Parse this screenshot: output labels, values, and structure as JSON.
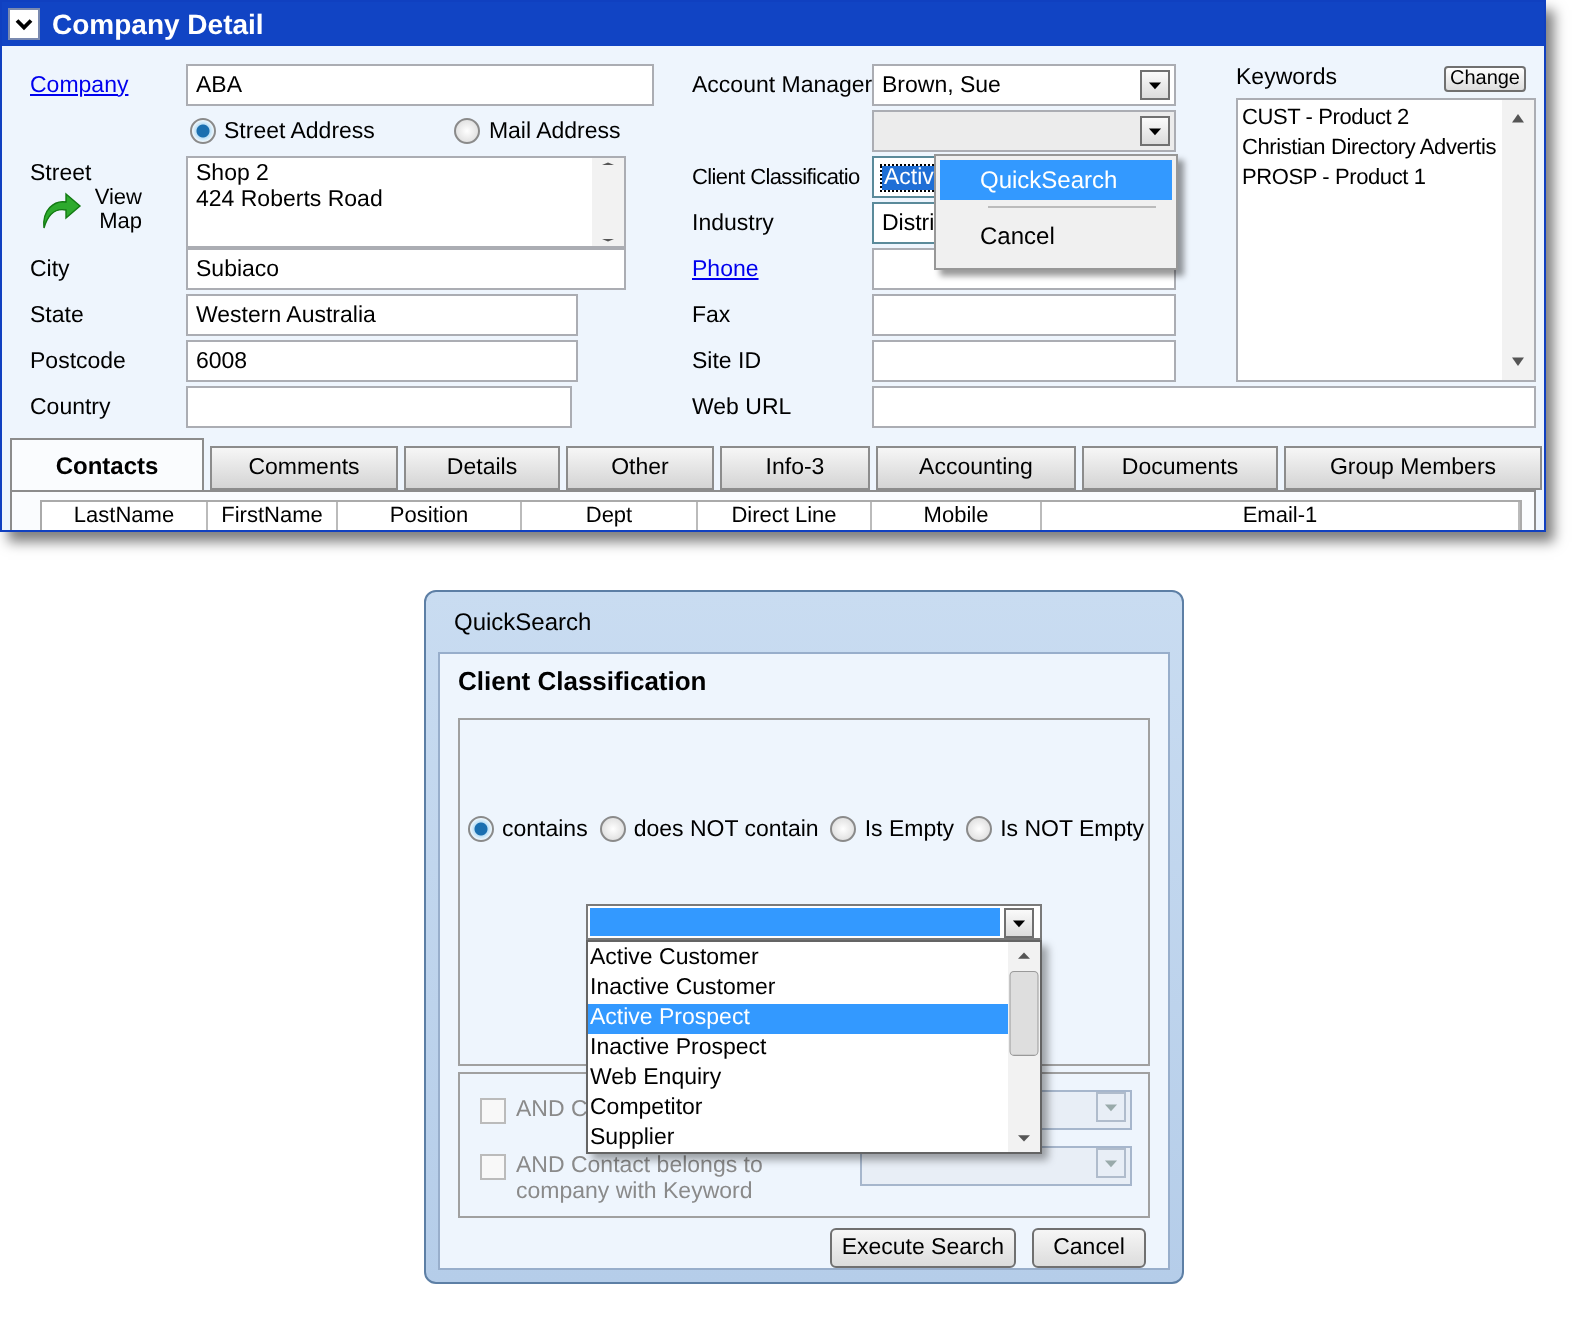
{
  "window": {
    "title": "Company Detail"
  },
  "company": {
    "label": "Company",
    "value": "ABA"
  },
  "address_types": [
    {
      "label": "Street Address",
      "selected": true
    },
    {
      "label": "Mail Address",
      "selected": false
    }
  ],
  "street": {
    "label": "Street",
    "map_link": "View Map",
    "lines": [
      "Shop 2",
      "424 Roberts Road"
    ]
  },
  "address_fields": [
    {
      "label": "City",
      "value": "Subiaco"
    },
    {
      "label": "State",
      "value": "Western Australia"
    },
    {
      "label": "Postcode",
      "value": "6008"
    },
    {
      "label": "Country"
    }
  ],
  "account_manager": {
    "label": "Account Manager",
    "value": "Brown, Sue"
  },
  "client_classification": {
    "label": "Client Classificatio",
    "value": "Activ"
  },
  "industry": {
    "label": "Industry",
    "value": "Distri"
  },
  "contact_fields": [
    {
      "label": "Phone",
      "kind": "link"
    },
    {
      "label": "Fax",
      "kind": "plain"
    },
    {
      "label": "Site ID",
      "kind": "plain"
    }
  ],
  "web_url": {
    "label": "Web URL"
  },
  "keywords": {
    "label": "Keywords",
    "button": "Change",
    "items": [
      "CUST - Product 2",
      "Christian Directory Advertis",
      "PROSP - Product 1"
    ]
  },
  "context_menu": [
    {
      "kind": "item",
      "label": "QuickSearch",
      "selected": true
    },
    {
      "kind": "separator"
    },
    {
      "kind": "item",
      "label": "Cancel",
      "selected": false
    }
  ],
  "tabs": [
    {
      "label": "Contacts",
      "selected": true
    },
    {
      "label": "Comments",
      "selected": false
    },
    {
      "label": "Details",
      "selected": false
    },
    {
      "label": "Other",
      "selected": false
    },
    {
      "label": "Info-3",
      "selected": false
    },
    {
      "label": "Accounting",
      "selected": false
    },
    {
      "label": "Documents",
      "selected": false
    },
    {
      "label": "Group Members",
      "selected": false
    }
  ],
  "contact_columns": [
    "LastName",
    "FirstName",
    "Position",
    "Dept",
    "Direct Line",
    "Mobile",
    "Email-1"
  ],
  "quick_search": {
    "title": "QuickSearch",
    "field": "Client Classification",
    "conditions": [
      {
        "label": "contains",
        "selected": true
      },
      {
        "label": "does NOT contain",
        "selected": false
      },
      {
        "label": "Is Empty",
        "selected": false
      },
      {
        "label": "Is NOT Empty",
        "selected": false
      }
    ],
    "options": [
      {
        "label": "Active Customer",
        "selected": false
      },
      {
        "label": "Inactive Customer",
        "selected": false
      },
      {
        "label": "Active Prospect",
        "selected": true
      },
      {
        "label": "Inactive Prospect",
        "selected": false
      },
      {
        "label": "Web Enquiry",
        "selected": false
      },
      {
        "label": "Competitor",
        "selected": false
      },
      {
        "label": "Supplier",
        "selected": false
      }
    ],
    "filters": [
      {
        "label": "AND C",
        "checked": false,
        "disabled": true
      },
      {
        "label": "AND Contact belongs to company with Keyword",
        "checked": false,
        "disabled": true
      }
    ],
    "buttons": [
      "Execute Search",
      "Cancel"
    ]
  }
}
